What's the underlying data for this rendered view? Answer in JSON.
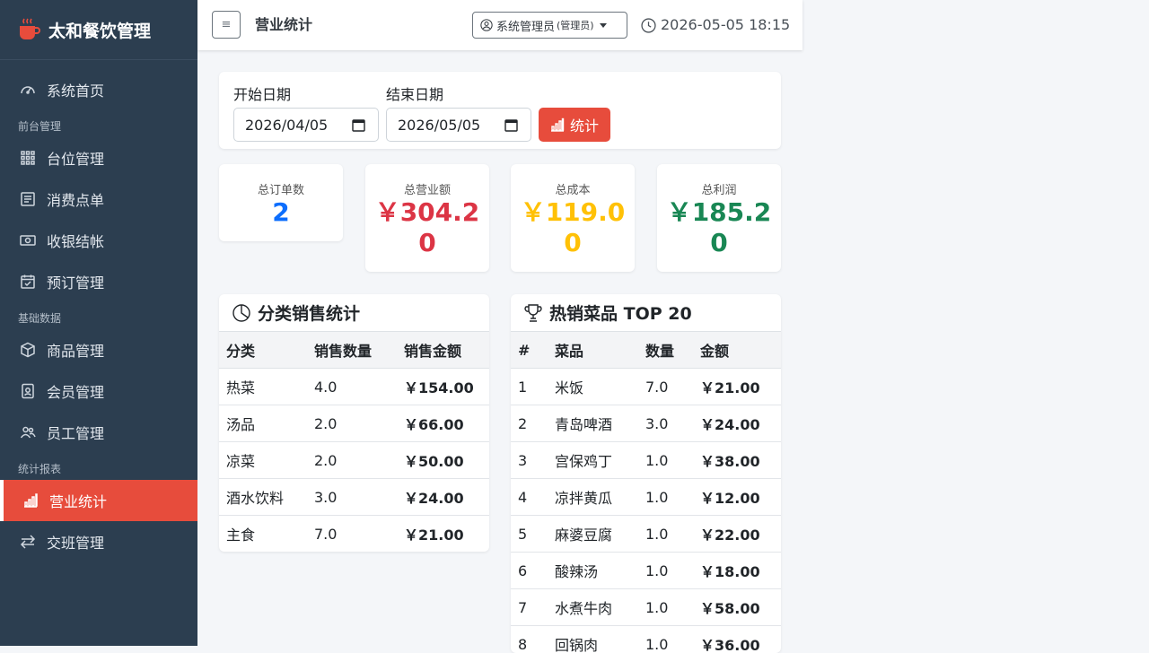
{
  "brand": {
    "name": "太和餐饮管理"
  },
  "sidebar": {
    "items": [
      {
        "label": "系统首页",
        "icon": "speedometer-icon"
      },
      {
        "section": "前台管理"
      },
      {
        "label": "台位管理",
        "icon": "grid-icon"
      },
      {
        "label": "消费点单",
        "icon": "receipt-icon"
      },
      {
        "label": "收银结帐",
        "icon": "cash-icon"
      },
      {
        "label": "预订管理",
        "icon": "calendar-check-icon"
      },
      {
        "section": "基础数据"
      },
      {
        "label": "商品管理",
        "icon": "box-icon"
      },
      {
        "label": "会员管理",
        "icon": "member-card-icon"
      },
      {
        "label": "员工管理",
        "icon": "people-icon"
      },
      {
        "section": "统计报表"
      },
      {
        "label": "营业统计",
        "icon": "bar-chart-icon",
        "active": true
      },
      {
        "label": "交班管理",
        "icon": "swap-arrows-icon"
      }
    ]
  },
  "header": {
    "menu_glyph": "≡",
    "title": "营业统计",
    "user_name": "系统管理员",
    "user_role": "(管理员)",
    "datetime": "2026-05-05 18:15"
  },
  "filter": {
    "start_label": "开始日期",
    "start_value": "2026/04/05",
    "end_label": "结束日期",
    "end_value": "2026/05/05",
    "button_label": "统计"
  },
  "stats": {
    "orders": {
      "label": "总订单数",
      "value": "2",
      "color": "#0d6efd"
    },
    "revenue": {
      "label": "总营业额",
      "value": "￥304.20",
      "color": "#dc3545"
    },
    "cost": {
      "label": "总成本",
      "value": "￥119.00",
      "color": "#ffc107"
    },
    "profit": {
      "label": "总利润",
      "value": "￥185.20",
      "color": "#198754"
    }
  },
  "category_table": {
    "title": "分类销售统计",
    "headers": [
      "分类",
      "销售数量",
      "销售金额"
    ],
    "rows": [
      [
        "热菜",
        "4.0",
        "￥154.00"
      ],
      [
        "汤品",
        "2.0",
        "￥66.00"
      ],
      [
        "凉菜",
        "2.0",
        "￥50.00"
      ],
      [
        "酒水饮料",
        "3.0",
        "￥24.00"
      ],
      [
        "主食",
        "7.0",
        "￥21.00"
      ]
    ]
  },
  "top_table": {
    "title": "热销菜品 TOP 20",
    "headers": [
      "#",
      "菜品",
      "数量",
      "金额"
    ],
    "rows": [
      [
        "1",
        "米饭",
        "7.0",
        "￥21.00"
      ],
      [
        "2",
        "青岛啤酒",
        "3.0",
        "￥24.00"
      ],
      [
        "3",
        "宫保鸡丁",
        "1.0",
        "￥38.00"
      ],
      [
        "4",
        "凉拌黄瓜",
        "1.0",
        "￥12.00"
      ],
      [
        "5",
        "麻婆豆腐",
        "1.0",
        "￥22.00"
      ],
      [
        "6",
        "酸辣汤",
        "1.0",
        "￥18.00"
      ],
      [
        "7",
        "水煮牛肉",
        "1.0",
        "￥58.00"
      ],
      [
        "8",
        "回锅肉",
        "1.0",
        "￥36.00"
      ]
    ]
  }
}
